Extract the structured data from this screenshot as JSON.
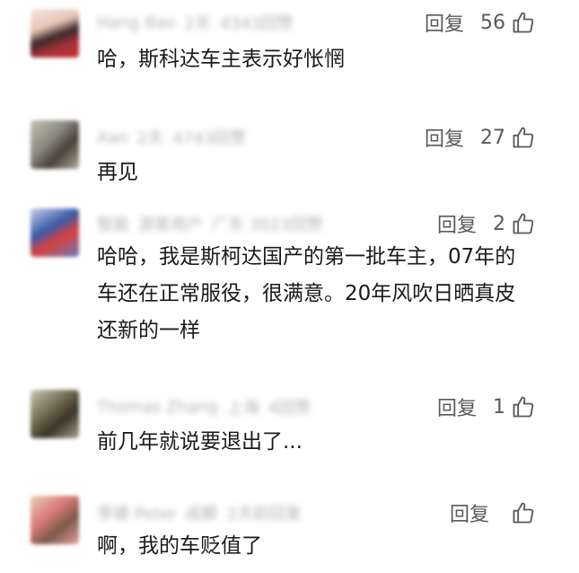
{
  "comments": [
    {
      "avatar_colors": [
        "#a8323a",
        "#e8c4b4",
        "#3a2a2a"
      ],
      "meta": {
        "user": "Hang Bao",
        "time": "2天",
        "location": "4343回赞"
      },
      "reply_label": "回复",
      "likes": "56",
      "text": "哈，斯科达车主表示好怅惘"
    },
    {
      "avatar_colors": [
        "#8a8a80",
        "#c8c0b0",
        "#4a4038"
      ],
      "meta": {
        "user": "Aan",
        "time": "2天",
        "location": "4743回赞"
      },
      "reply_label": "回复",
      "likes": "27",
      "text": "再见"
    },
    {
      "avatar_colors": [
        "#3a5aa8",
        "#d84040",
        "#c8d0e8"
      ],
      "meta": {
        "user": "智能",
        "time": "游客用户",
        "location": "广东 3023回赞"
      },
      "reply_label": "回复",
      "likes": "2",
      "text": "哈哈，我是斯柯达国产的第一批车主，07年的车还在正常服役，很满意。20年风吹日晒真皮还新的一样"
    },
    {
      "avatar_colors": [
        "#6a6048",
        "#c8c8b8",
        "#3a3428"
      ],
      "meta": {
        "user": "Thomas Zhang",
        "time": "上海",
        "location": "4回赞"
      },
      "reply_label": "回复",
      "likes": "1",
      "text": "前几年就说要退出了..."
    },
    {
      "avatar_colors": [
        "#d87878",
        "#e8d0b8",
        "#7a5a4a"
      ],
      "meta": {
        "user": "李健 Peter",
        "time": "成都",
        "location": "2天前回复"
      },
      "reply_label": "回复",
      "likes": "",
      "text": "啊，我的车贬值了"
    }
  ],
  "icons": {
    "like": "thumbs-up-icon"
  },
  "colors": {
    "text": "#1a1a1a",
    "muted": "#5a5a5a",
    "background": "#ffffff"
  }
}
